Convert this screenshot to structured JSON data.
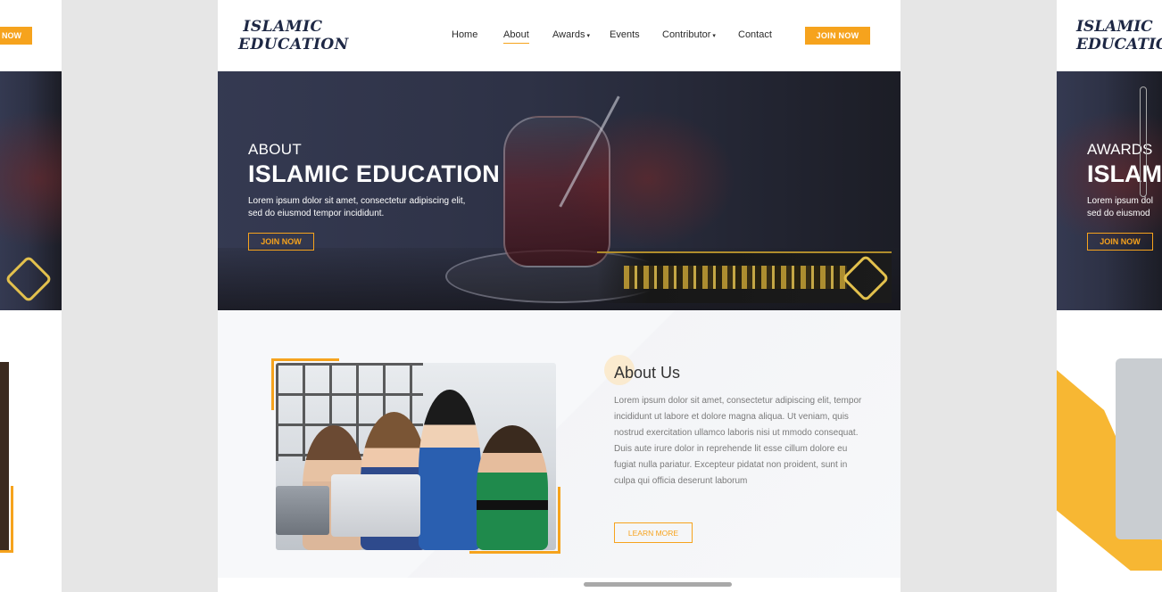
{
  "brand": {
    "logo_line1": "ISLAMIC",
    "logo_line2": "EDUCATION"
  },
  "nav": {
    "items": [
      {
        "label": "Home"
      },
      {
        "label": "About",
        "active": true
      },
      {
        "label": "Awards",
        "has_dropdown": true
      },
      {
        "label": "Events"
      },
      {
        "label": "Contributor",
        "has_dropdown": true
      },
      {
        "label": "Contact"
      }
    ],
    "caret": "▾",
    "join_label": "JOIN NOW"
  },
  "hero": {
    "kicker": "ABOUT",
    "title": "ISLAMIC EDUCATION",
    "desc_line1": "Lorem ipsum dolor sit amet, consectetur adipiscing elit,",
    "desc_line2": "sed do eiusmod tempor incididunt.",
    "button_label": "JOIN NOW"
  },
  "about": {
    "title": "About Us",
    "text": "Lorem ipsum dolor sit amet, consectetur adipiscing elit, tempor incididunt ut labore et dolore magna aliqua. Ut veniam, quis nostrud exercitation ullamco laboris nisi ut mmodo consequat. Duis aute irure dolor in reprehende lit esse cillum dolore eu fugiat nulla pariatur. Excepteur pidatat non proident, sunt in culpa qui officia deserunt laborum",
    "button_label": "LEARN MORE"
  },
  "left_panel": {
    "join_label": "NOW"
  },
  "right_panel": {
    "logo_line1": "ISLAMIC",
    "logo_line2": "EDUCATION",
    "kicker": "AWARDS",
    "title": "ISLAMI",
    "desc_line1": "Lorem ipsum dol",
    "desc_line2": "sed do eiusmod",
    "button_label": "JOIN NOW"
  },
  "colors": {
    "accent": "#f6a31d",
    "brand_navy": "#1d2744",
    "hero_overlay": "#2c3044",
    "page_bg": "#e6e6e6"
  }
}
